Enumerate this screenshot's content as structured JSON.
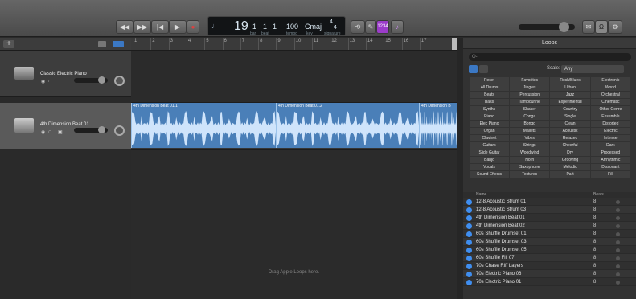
{
  "toolbar": {
    "rewind_icon": "rewind-icon",
    "forward_icon": "fast-forward-icon",
    "tostart_icon": "go-to-start-icon",
    "play_icon": "play-icon",
    "record_icon": "record-icon",
    "lcd": {
      "bar": "19",
      "beat": "1",
      "div": "1",
      "tick": "1",
      "tempo": "100",
      "key": "Cmaj",
      "sig_top": "4",
      "sig_bottom": "4",
      "sub_bar": "bar",
      "sub_beat": "beat",
      "sub_tempo": "tempo",
      "sub_key": "key",
      "sub_sig": "signature"
    },
    "count_in_label": "1234",
    "colors": {
      "accent": "#9b3cc9",
      "lcd_text": "#d8e6f0",
      "play": "#ddd",
      "record": "#e04040"
    }
  },
  "ruler": {
    "ticks": [
      "1",
      "2",
      "3",
      "4",
      "5",
      "6",
      "7",
      "8",
      "9",
      "10",
      "11",
      "12",
      "13",
      "14",
      "15",
      "16",
      "17"
    ]
  },
  "tracks": [
    {
      "name": "Classic Electric Piano"
    },
    {
      "name": "4th Dimension Beat 01"
    }
  ],
  "regions": [
    {
      "label": "4th Dimension Beat 01.1"
    },
    {
      "label": "4th Dimension Beat 01.2"
    },
    {
      "label": "4th Dimension B"
    }
  ],
  "drop_hint": "Drag Apple Loops here.",
  "loops": {
    "title": "Loops",
    "search_placeholder": "Q-",
    "scale_label": "Scale:",
    "scale_value": "Any",
    "grid": [
      [
        "Reset",
        "Favorites",
        "Rock/Blues",
        "Electronic"
      ],
      [
        "All Drums",
        "Jingles",
        "Urban",
        "World"
      ],
      [
        "Beats",
        "Percussion",
        "Jazz",
        "Orchestral"
      ],
      [
        "Bass",
        "Tambourine",
        "Experimental",
        "Cinematic"
      ],
      [
        "Synths",
        "Shaker",
        "Country",
        "Other Genre"
      ],
      [
        "Piano",
        "Conga",
        "Single",
        "Ensemble"
      ],
      [
        "Elec Piano",
        "Bongo",
        "Clean",
        "Distorted"
      ],
      [
        "Organ",
        "Mallets",
        "Acoustic",
        "Electric"
      ],
      [
        "Clavinet",
        "Vibes",
        "Relaxed",
        "Intense"
      ],
      [
        "Guitars",
        "Strings",
        "Cheerful",
        "Dark"
      ],
      [
        "Slide Guitar",
        "Woodwind",
        "Dry",
        "Processed"
      ],
      [
        "Banjo",
        "Horn",
        "Grooving",
        "Arrhythmic"
      ],
      [
        "Vocals",
        "Saxophone",
        "Melodic",
        "Dissonant"
      ],
      [
        "Sound Effects",
        "Textures",
        "Part",
        "Fill"
      ]
    ],
    "list_header": {
      "name": "Name",
      "beats": "Beats"
    },
    "list": [
      {
        "name": "12-8 Acoustic Strum 01",
        "beats": "8"
      },
      {
        "name": "12-8 Acoustic Strum 03",
        "beats": "8"
      },
      {
        "name": "4th Dimension Beat 01",
        "beats": "8"
      },
      {
        "name": "4th Dimension Beat 02",
        "beats": "8"
      },
      {
        "name": "60s Shuffle Drumset 01",
        "beats": "8"
      },
      {
        "name": "60s Shuffle Drumset 03",
        "beats": "8"
      },
      {
        "name": "60s Shuffle Drumset 05",
        "beats": "8"
      },
      {
        "name": "60s Shuffle Fill 07",
        "beats": "8"
      },
      {
        "name": "70s Chase Riff Layers",
        "beats": "8"
      },
      {
        "name": "70s Electric Piano 06",
        "beats": "8"
      },
      {
        "name": "70s Electric Piano 01",
        "beats": "8"
      }
    ]
  }
}
